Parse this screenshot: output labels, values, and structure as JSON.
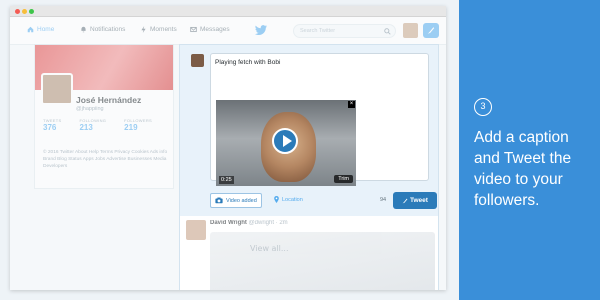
{
  "nav": {
    "items": [
      {
        "label": "Home",
        "icon": "home-icon",
        "active": true
      },
      {
        "label": "Notifications",
        "icon": "bell-icon"
      },
      {
        "label": "Moments",
        "icon": "lightning-icon"
      },
      {
        "label": "Messages",
        "icon": "envelope-icon"
      }
    ],
    "search_placeholder": "Search Twitter"
  },
  "profile": {
    "name": "José Hernández",
    "handle": "@jhappiing",
    "stats": [
      {
        "label": "TWEETS",
        "value": "376"
      },
      {
        "label": "FOLLOWING",
        "value": "213"
      },
      {
        "label": "FOLLOWERS",
        "value": "219"
      }
    ],
    "footer": "© 2016 Twitter   About   Help   Terms   Privacy   Cookies   Ads info   Brand   Blog   Status   Apps   Jobs   Advertise   Businesses   Media   Developers"
  },
  "composer": {
    "text": "Playing fetch with Bobi",
    "video_time": "0:25",
    "trim_label": "Trim",
    "close_label": "×",
    "video_added_label": "Video added",
    "location_label": "Location",
    "char_count": "94",
    "tweet_label": "Tweet"
  },
  "feed": {
    "name": "David Wright",
    "handle": "@dwright · 2m",
    "image_text": "View all..."
  },
  "panel": {
    "step": "3",
    "text": "Add a caption and Tweet the video to your followers."
  },
  "colors": {
    "accent": "#55acee",
    "button": "#2b7bb9",
    "panel": "#3a8fd9"
  }
}
